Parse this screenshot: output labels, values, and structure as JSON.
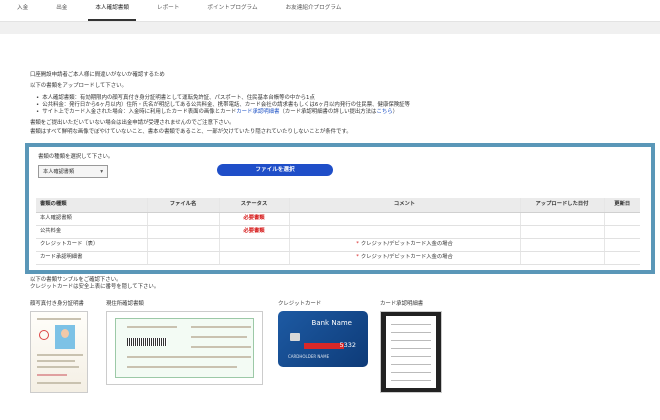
{
  "nav": {
    "tabs": [
      {
        "label": "入金",
        "active": false
      },
      {
        "label": "出金",
        "active": false
      },
      {
        "label": "本人確認書類",
        "active": true
      },
      {
        "label": "レポート",
        "active": false
      },
      {
        "label": "ポイントプログラム",
        "active": false
      },
      {
        "label": "お友達紹介プログラム",
        "active": false
      }
    ]
  },
  "intro": {
    "line1": "口座開設申請者ご本人様に間違いがないか確認するため",
    "line2": "以下の書類をアップロードして下さい。",
    "bullet1": "本人確認書類：有効期限内の顔写真付き身分証明書として運転免許証、パスポート、住民基本台帳等の中から1点",
    "bullet2": "公共料金：発行日から6ヶ月以内）住所・氏名が明記してある公共料金、携帯電話、カード会社の請求書もしくは6ヶ月以内発行の住民票、健康保険証等",
    "bullet3_pre": "サイト上でカード入金された場合：入金時に利用したカード表面の画像とカード",
    "bullet3_link": "カード承認明細書",
    "bullet3_mid": "（カード承認明細書の詳しい提出方法は",
    "bullet3_link2": "こちら",
    "bullet3_post": "）",
    "note1": "書類をご提出いただいていない場合は出金申請が受理されませんのでご注意下さい。",
    "note2": "書類はすべて鮮明な画像でぼやけていないこと、書本の書類であること、一部が欠けていたり隠されていたりしないことが条件です。"
  },
  "form": {
    "select_label": "書類の種類を選択して下さい。",
    "select_value": "本人確認書類",
    "file_button": "ファイルを選択"
  },
  "table": {
    "headers": [
      "書類の種類",
      "ファイル名",
      "ステータス",
      "コメント",
      "アップロードした日付",
      "更新日"
    ],
    "rows": [
      {
        "type": "本人確認書類",
        "file": "",
        "status": "必要書類",
        "comment": "",
        "date": "",
        "updated": ""
      },
      {
        "type": "公共料金",
        "file": "",
        "status": "必要書類",
        "comment": "",
        "date": "",
        "updated": ""
      },
      {
        "type": "クレジットカード（表）",
        "file": "",
        "status": "",
        "comment": "クレジット/デビットカード入金の場合",
        "date": "",
        "updated": ""
      },
      {
        "type": "カード承認明細書",
        "file": "",
        "status": "",
        "comment": "クレジット/デビットカード入金の場合",
        "date": "",
        "updated": ""
      }
    ]
  },
  "samples": {
    "note1": "以下の書類サンプルをご確認下さい。",
    "note2": "クレジットカードは安全上表に番号を隠して下さい。",
    "items": [
      {
        "label": "顔写真付き身分証明書"
      },
      {
        "label": "現住所確認書類"
      },
      {
        "label": "クレジットカード",
        "bank": "Bank Name",
        "card_number": "5332",
        "holder": "CARDHOLDER NAME"
      },
      {
        "label": "カード承認明細書"
      }
    ]
  },
  "colors": {
    "panel_border": "#5a97b8",
    "button_bg": "#1f4ec8",
    "required_text": "#d61a1a",
    "link": "#1a4fc4"
  }
}
